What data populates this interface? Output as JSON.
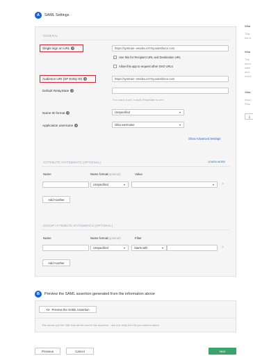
{
  "step_a": {
    "badge": "A",
    "title": "SAML Settings"
  },
  "general": {
    "section": "GENERAL",
    "sso_url_label": "Single sign on URL",
    "sso_url_value": "https://symtrain--sssdev.cs7my.salesforce.com",
    "use_for_recipient": "Use this for Recipient URL and Destination URL",
    "allow_other_sso": "Allow this app to request other SSO URLs",
    "audience_label": "Audience URI (SP Entity ID)",
    "audience_value": "https://symtrain--sssdev.cs7my.salesforce.com",
    "relay_label": "Default RelayState",
    "relay_value": "",
    "relay_hint": "If no value is set, a blank RelayState is sent",
    "nameid_label": "Name ID format",
    "nameid_value": "Unspecified",
    "username_label": "Application username",
    "username_value": "Okta username",
    "advanced_link": "Show Advanced Settings"
  },
  "attributes": {
    "section": "ATTRIBUTE STATEMENTS (OPTIONAL)",
    "learn_more": "LEARN MORE",
    "col_name": "Name",
    "col_format": "Name format",
    "col_format_opt": "(optional)",
    "col_value": "Value",
    "format_value": "Unspecified",
    "remove": "×",
    "add_button": "Add Another"
  },
  "groups": {
    "section": "GROUP ATTRIBUTE STATEMENTS (OPTIONAL)",
    "col_name": "Name",
    "col_format": "Name format",
    "col_format_opt": "(optional)",
    "col_filter": "Filter",
    "format_value": "Unspecified",
    "filter_value": "Starts with",
    "remove": "×",
    "add_button": "Add Another"
  },
  "step_b": {
    "badge": "B",
    "title": "Preview the SAML assertion generated from the information above",
    "preview_button": "Preview the SAML Assertion",
    "preview_icon": "<>",
    "note": "This shows you the XML that will be used in the assertion - use it to verify the info you entered above"
  },
  "footer": {
    "previous": "Previous",
    "cancel": "Cancel",
    "next": "Next"
  },
  "sidebar": {
    "heading1": "Wha",
    "text1a": "This",
    "text1b": "the a",
    "heading2": "Wha",
    "text2a": "The",
    "text2b": "shou",
    "text2c": "sidel",
    "text2d": "and",
    "text2e": "need",
    "heading3": "Okta",
    "text3a": "Impo",
    "text3b": "Prov",
    "download_icon": "⤓"
  },
  "colors": {
    "accent": "#1662dd",
    "highlight": "#d9232e",
    "primary_button": "#3aa36b"
  }
}
